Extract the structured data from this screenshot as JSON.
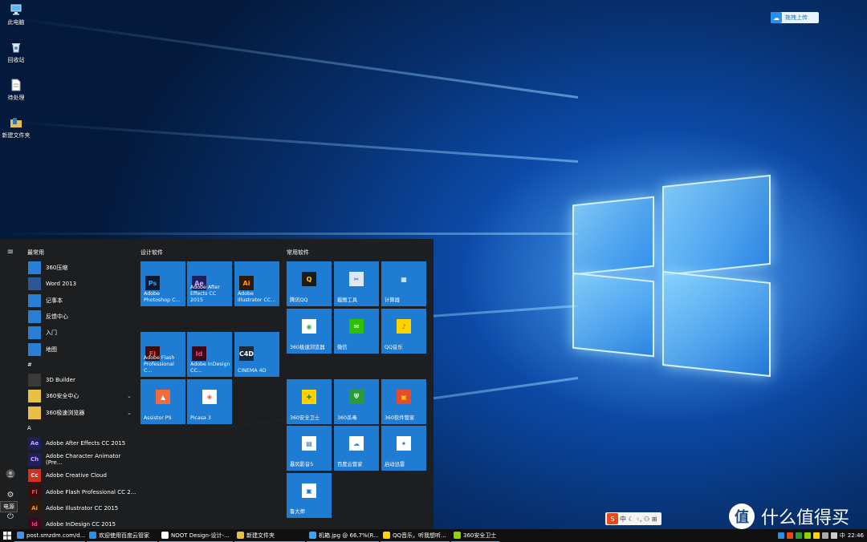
{
  "desktop": {
    "icons": [
      {
        "label": "此电脑",
        "icon": "computer-icon"
      },
      {
        "label": "回收站",
        "icon": "recycle-bin-icon"
      },
      {
        "label": "待处理",
        "icon": "document-icon"
      },
      {
        "label": "新建文件夹",
        "icon": "folder-icon"
      }
    ],
    "cloud_button": "拖拽上传"
  },
  "start_menu": {
    "power_tooltip": "电源",
    "sections": {
      "most_used": "最常用",
      "hash": "#",
      "a": "A"
    },
    "most_used": [
      {
        "label": "360压缩",
        "color": "#2a7fd4"
      },
      {
        "label": "Word 2013",
        "color": "#2b5797"
      },
      {
        "label": "记事本",
        "color": "#2a7fd4"
      },
      {
        "label": "反馈中心",
        "color": "#2a7fd4"
      },
      {
        "label": "入门",
        "color": "#2a7fd4"
      },
      {
        "label": "地图",
        "color": "#2a7fd4"
      }
    ],
    "hash_apps": [
      {
        "label": "3D Builder",
        "color": "#3a3a3a",
        "expand": false
      },
      {
        "label": "360安全中心",
        "color": "#e8c046",
        "expand": true
      },
      {
        "label": "360极速浏览器",
        "color": "#e8c046",
        "expand": true
      }
    ],
    "a_apps": [
      {
        "label": "Adobe After Effects CC 2015",
        "abbr": "Ae",
        "color": "#1f1f5c",
        "fg": "#c9a6ff"
      },
      {
        "label": "Adobe Character Animator (Pre...",
        "abbr": "Ch",
        "color": "#1f1f5c",
        "fg": "#c9a6ff"
      },
      {
        "label": "Adobe Creative Cloud",
        "abbr": "Cc",
        "color": "#d62e20",
        "fg": "#fff"
      },
      {
        "label": "Adobe Flash Professional CC 2...",
        "abbr": "Fl",
        "color": "#3a0e0e",
        "fg": "#ff4a3d"
      },
      {
        "label": "Adobe Illustrator CC 2015",
        "abbr": "Ai",
        "color": "#2e1a06",
        "fg": "#ff9a1f"
      },
      {
        "label": "Adobe InDesign CC 2015",
        "abbr": "Id",
        "color": "#3a0a1c",
        "fg": "#ff3d77"
      }
    ],
    "groups": {
      "design": "设计软件",
      "common": "常用软件"
    },
    "design_tiles": [
      {
        "label": "Adobe Photoshop C...",
        "abbr": "Ps",
        "ic_bg": "#0b1a2e",
        "ic_fg": "#31a8ff"
      },
      {
        "label": "Adobe After Effects CC 2015",
        "abbr": "Ae",
        "ic_bg": "#1f1f5c",
        "ic_fg": "#c9a6ff"
      },
      {
        "label": "Adobe Illustrator CC...",
        "abbr": "Ai",
        "ic_bg": "#2e1a06",
        "ic_fg": "#ff9a1f"
      },
      {
        "label": "Adobe Flash Professional C...",
        "abbr": "Fl",
        "ic_bg": "#3a0e0e",
        "ic_fg": "#ff4a3d"
      },
      {
        "label": "Adobe InDesign CC...",
        "abbr": "Id",
        "ic_bg": "#3a0a1c",
        "ic_fg": "#ff3d77"
      },
      {
        "label": "CINEMA 4D",
        "abbr": "C4D",
        "ic_bg": "#1a2a3a",
        "ic_fg": "#ffffff"
      },
      {
        "label": "Assistor PS",
        "abbr": "▲",
        "ic_bg": "#f26b3a",
        "ic_fg": "#ffffff"
      },
      {
        "label": "Picasa 3",
        "abbr": "❀",
        "ic_bg": "#ffffff",
        "ic_fg": "#e94d3a"
      }
    ],
    "common_tiles": [
      {
        "label": "腾讯QQ",
        "abbr": "Q",
        "ic_bg": "#1a1a1a",
        "ic_fg": "#ffcc00"
      },
      {
        "label": "截图工具",
        "abbr": "✂",
        "ic_bg": "#dfe9f5",
        "ic_fg": "#2a5aa0"
      },
      {
        "label": "计算器",
        "abbr": "▦",
        "ic_bg": "transparent",
        "ic_fg": "#ffffff"
      },
      {
        "label": "360极速浏览器",
        "abbr": "◉",
        "ic_bg": "#ffffff",
        "ic_fg": "#3bb34a"
      },
      {
        "label": "微信",
        "abbr": "✉",
        "ic_bg": "#2dc100",
        "ic_fg": "#ffffff"
      },
      {
        "label": "QQ音乐",
        "abbr": "♪",
        "ic_bg": "#ffd200",
        "ic_fg": "#2b8a3a"
      },
      {
        "label": "360安全卫士",
        "abbr": "✚",
        "ic_bg": "#ffd200",
        "ic_fg": "#2b8a3a"
      },
      {
        "label": "360杀毒",
        "abbr": "⛨",
        "ic_bg": "#2b9a3a",
        "ic_fg": "#ffffff"
      },
      {
        "label": "360软件管家",
        "abbr": "▣",
        "ic_bg": "#e84a2e",
        "ic_fg": "#ffd200"
      },
      {
        "label": "暴风影音5",
        "abbr": "▤",
        "ic_bg": "#ffffff",
        "ic_fg": "#1f5fb0"
      },
      {
        "label": "百度云管家",
        "abbr": "☁",
        "ic_bg": "#ffffff",
        "ic_fg": "#2a8fe8"
      },
      {
        "label": "启动迅雷",
        "abbr": "✦",
        "ic_bg": "#ffffff",
        "ic_fg": "#1f6fd0"
      },
      {
        "label": "鲁大师",
        "abbr": "▣",
        "ic_bg": "#ffffff",
        "ic_fg": "#1f6fd0"
      }
    ]
  },
  "ime": {
    "logo": "S",
    "text": "中 ☾ ◦, ⚇ ⊞"
  },
  "watermark": {
    "text": "什么值得买",
    "logo": "值"
  },
  "taskbar": {
    "items": [
      {
        "label": "post.smzdm.com/d...",
        "color": "#4a8fe8"
      },
      {
        "label": "欢迎使用百度云管家",
        "color": "#2a8fe8"
      },
      {
        "label": "NOOT Design-设计-...",
        "color": "#ffffff"
      },
      {
        "label": "新建文件夹",
        "color": "#e8c046"
      },
      {
        "label": "机箱.jpg @ 66.7%(R...",
        "color": "#31a8ff"
      },
      {
        "label": "QQ音乐，听我想听...",
        "color": "#ffd200"
      },
      {
        "label": "360安全卫士",
        "color": "#8fd400"
      }
    ],
    "lang": "中",
    "time": "22:46"
  }
}
